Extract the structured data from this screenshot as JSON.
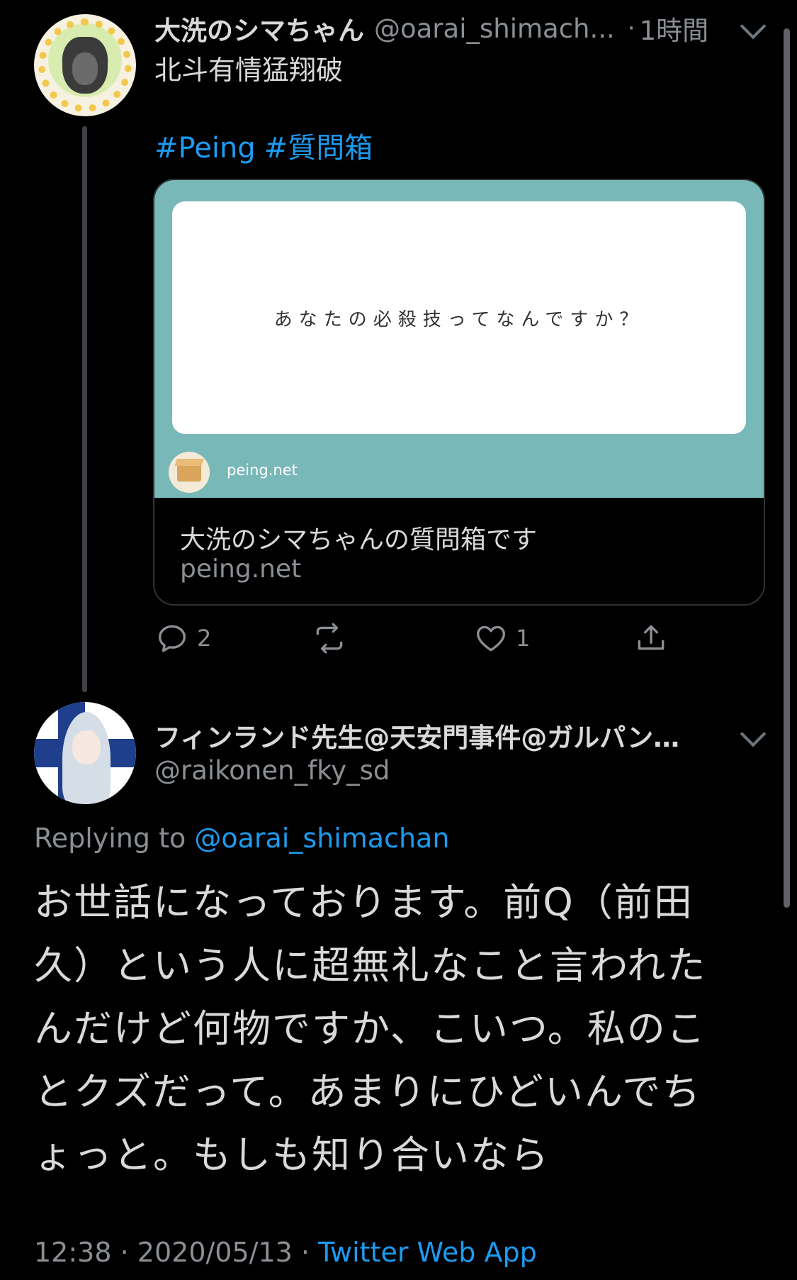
{
  "colors": {
    "background": "#000000",
    "accent": "#1d9bf0",
    "text_primary": "#d9d9d9",
    "text_secondary": "#8b8f94",
    "card_teal": "#79b8b8"
  },
  "tweet1": {
    "display_name": "大洗のシマちゃん",
    "handle": "@oarai_shimach...",
    "separator": "·",
    "time": "1時間",
    "text": "北斗有情猛翔破",
    "hashtags": [
      "#Peing",
      "#質問箱"
    ],
    "card": {
      "question": "あなたの必殺技ってなんですか？",
      "brand": "peing.net",
      "title": "大洗のシマちゃんの質問箱です",
      "domain": "peing.net"
    },
    "actions": {
      "reply_icon": "reply-icon",
      "reply_count": "2",
      "retweet_icon": "retweet-icon",
      "like_icon": "heart-icon",
      "like_count": "1",
      "share_icon": "share-icon"
    }
  },
  "tweet2": {
    "display_name": "フィンランド先生@天安門事件@ガルパン…",
    "handle": "@raikonen_fky_sd",
    "replying_prefix": "Replying to",
    "replying_to": "@oarai_shimachan",
    "body_lines": [
      "お世話になっております。前Q（前田",
      "久）という人に超無礼なこと言われた",
      "んだけど何物ですか、こいつ。私のこ",
      "とクズだって。あまりにひどいんでち",
      "ょっと。もしも知り合いなら"
    ],
    "time": "12:38",
    "date": "2020/05/13",
    "separator": "·",
    "source": "Twitter Web App"
  }
}
